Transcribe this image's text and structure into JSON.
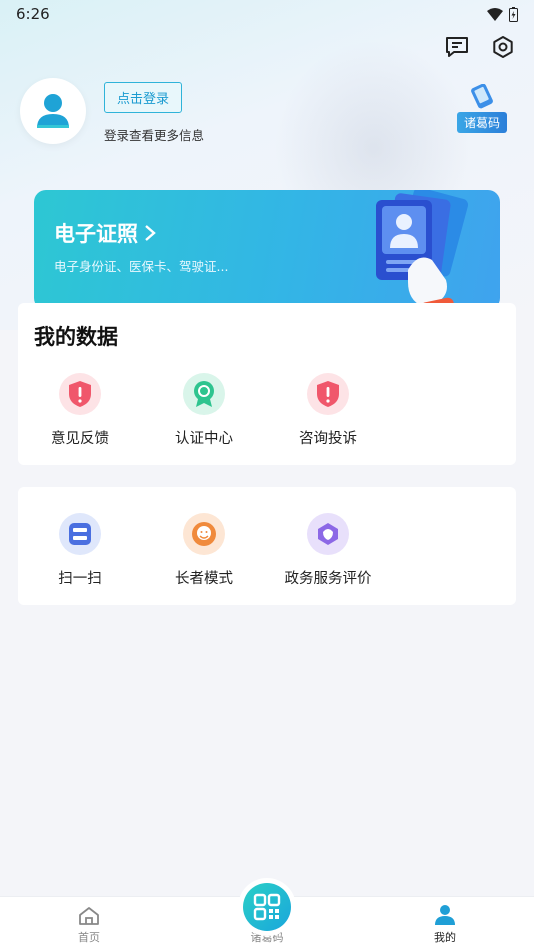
{
  "status_bar": {
    "time": "6:26"
  },
  "profile": {
    "login_button": "点击登录",
    "login_hint": "登录查看更多信息"
  },
  "zhuge": {
    "label": "诸葛码"
  },
  "cert_card": {
    "title": "电子证照",
    "subtitle": "电子身份证、医保卡、驾驶证..."
  },
  "my_data": {
    "title": "我的数据",
    "items": [
      {
        "label": "意见反馈",
        "icon": "feedback-icon",
        "color": "#f0576b"
      },
      {
        "label": "认证中心",
        "icon": "certification-icon",
        "color": "#2ec48f"
      },
      {
        "label": "咨询投诉",
        "icon": "complaint-icon",
        "color": "#f0576b"
      }
    ]
  },
  "tools": {
    "items": [
      {
        "label": "扫一扫",
        "icon": "scan-icon",
        "color": "#4a6fe0"
      },
      {
        "label": "长者模式",
        "icon": "elder-mode-icon",
        "color": "#f08a3c"
      },
      {
        "label": "政务服务评价",
        "icon": "service-rating-icon",
        "color": "#8c68e6"
      }
    ]
  },
  "bottom_nav": {
    "items": [
      {
        "label": "首页",
        "icon": "home-icon",
        "active": false
      },
      {
        "label": "诸葛码",
        "icon": "qr-code-icon",
        "active": false
      },
      {
        "label": "我的",
        "icon": "profile-icon",
        "active": true
      }
    ]
  },
  "colors": {
    "accent": "#2ab7dc",
    "active_nav": "#1f9fd6"
  }
}
